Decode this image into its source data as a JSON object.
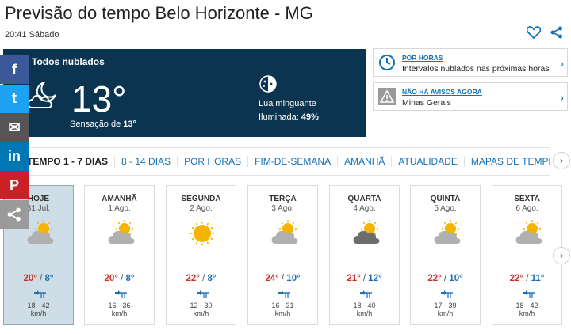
{
  "page": {
    "title": "Previsão do tempo Belo Horizonte - MG",
    "subtitle": "20:41 Sábado",
    "icons": [
      "heart-icon",
      "share-icon"
    ]
  },
  "current": {
    "condition": "Todos nublados",
    "temperature": "13°",
    "feels_label": "Sensação de",
    "feels_value": "13°",
    "moon_phase": "Lua minguante",
    "illuminated_label": "Iluminada:",
    "illuminated_value": "49%",
    "bg_color": "#0b3450"
  },
  "cards": [
    {
      "label": "POR HORAS",
      "value": "Intervalos nublados nas próximas horas",
      "icon": "clock-icon"
    },
    {
      "label": "NÃO HÁ AVISOS AGORA",
      "value": "Minas Gerais",
      "icon": "warning-icon"
    }
  ],
  "social": [
    {
      "name": "facebook",
      "glyph": "f",
      "color": "#3b5998"
    },
    {
      "name": "twitter",
      "glyph": "t",
      "color": "#1da1f2"
    },
    {
      "name": "email",
      "glyph": "✉",
      "color": "#555555"
    },
    {
      "name": "linkedin",
      "glyph": "in",
      "color": "#0077b5"
    },
    {
      "name": "pinterest",
      "glyph": "P",
      "color": "#cb2027"
    },
    {
      "name": "share",
      "glyph": "share",
      "color": "#9a9a9a"
    }
  ],
  "tabs": [
    "TEMPO 1 - 7 DIAS",
    "8 - 14 DIAS",
    "POR HORAS",
    "FIM-DE-SEMANA",
    "AMANHÃ",
    "ATUALIDADE",
    "MAPAS DE TEMPERATURA"
  ],
  "days": [
    {
      "name": "HOJE",
      "date": "31 Jul.",
      "icon": "partly-cloudy",
      "max": "20°",
      "min": "8°",
      "wind": "18 - 42",
      "unit": "km/h"
    },
    {
      "name": "AMANHÃ",
      "date": "1 Ago.",
      "icon": "partly-cloudy",
      "max": "20°",
      "min": "8°",
      "wind": "16 - 36",
      "unit": "km/h"
    },
    {
      "name": "SEGUNDA",
      "date": "2 Ago.",
      "icon": "sunny",
      "max": "22°",
      "min": "8°",
      "wind": "12 - 30",
      "unit": "km/h"
    },
    {
      "name": "TERÇA",
      "date": "3 Ago.",
      "icon": "partly-cloudy",
      "max": "24°",
      "min": "10°",
      "wind": "16 - 31",
      "unit": "km/h"
    },
    {
      "name": "QUARTA",
      "date": "4 Ago.",
      "icon": "cloudy",
      "max": "21°",
      "min": "12°",
      "wind": "18 - 40",
      "unit": "km/h"
    },
    {
      "name": "QUINTA",
      "date": "5 Ago.",
      "icon": "partly-cloudy",
      "max": "22°",
      "min": "10°",
      "wind": "17 - 39",
      "unit": "km/h"
    },
    {
      "name": "SEXTA",
      "date": "6 Ago.",
      "icon": "partly-cloudy",
      "max": "22°",
      "min": "11°",
      "wind": "18 - 42",
      "unit": "km/h"
    }
  ],
  "colors": {
    "accent": "#1472b8",
    "max_temp": "#c8302c",
    "min_temp": "#1e6eb3",
    "today_bg": "#cfdde6"
  }
}
